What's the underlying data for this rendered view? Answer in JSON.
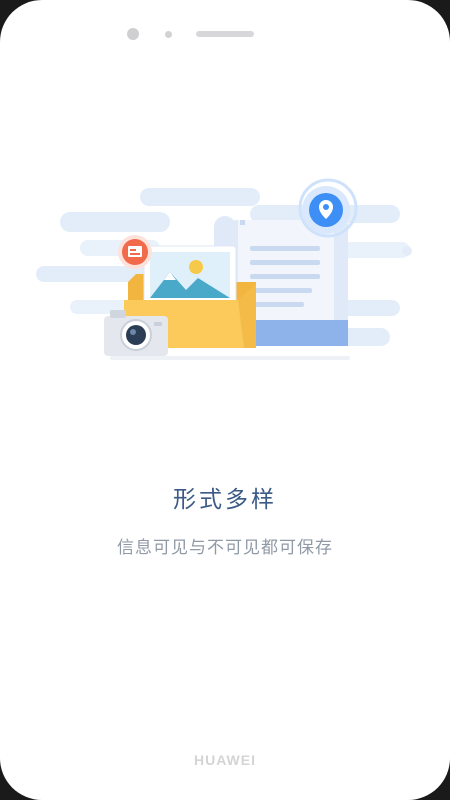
{
  "device": {
    "brand": "HUAWEI"
  },
  "onboarding": {
    "title": "形式多样",
    "subtitle": "信息可见与不可见都可保存"
  },
  "colors": {
    "title": "#3c5a86",
    "subtitle": "#909aa6",
    "folder": "#fcca5a",
    "document": "#eef3fb",
    "location_pin": "#3d8ff5",
    "badge": "#f06a4b",
    "cloud": "#e3edfa"
  },
  "icons": {
    "location": "location-pin-icon",
    "image": "image-icon",
    "camera": "camera-icon",
    "document": "document-icon",
    "folder": "folder-icon",
    "card": "card-badge-icon"
  }
}
